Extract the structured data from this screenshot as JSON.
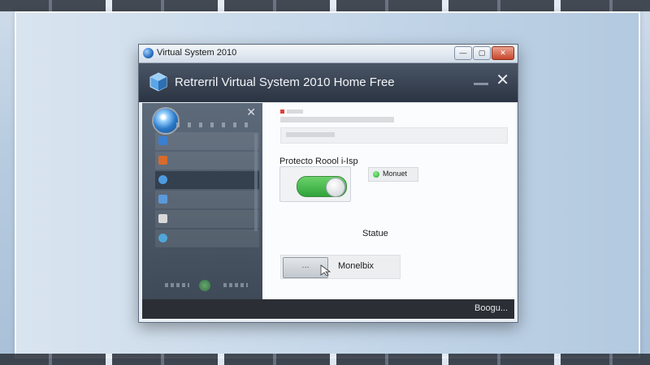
{
  "window": {
    "title": "Virtual System 2010",
    "buttons": {
      "minimize": "—",
      "maximize": "▢",
      "close": "✕"
    }
  },
  "header": {
    "title": "Retrerril Virtual System 2010 Home Free",
    "close": "✕"
  },
  "sidebar": {
    "close": "✕",
    "items": [
      {
        "icon": "color-icon",
        "color": "#3b7fd0"
      },
      {
        "icon": "flag-icon",
        "color": "#d86a2c"
      },
      {
        "icon": "search-icon",
        "color": "#4d9be0"
      },
      {
        "icon": "document-icon",
        "color": "#5a9ad9"
      },
      {
        "icon": "shield-icon",
        "color": "#d9d9d9"
      },
      {
        "icon": "globe-icon",
        "color": "#4fa6d8"
      }
    ]
  },
  "content": {
    "protect_label": "Protecto Roool i-Isp",
    "toggle_on": true,
    "monitor_chip_label": "Monuet",
    "status_label": "Statue",
    "monitor_button_label": "·∙·",
    "monitor_label": "Monelbix"
  },
  "statusbar": {
    "text": "Boogu..."
  },
  "colors": {
    "accent_green": "#2fa33a",
    "header_dark": "#2b3442",
    "status_dark": "#2b2f35"
  }
}
